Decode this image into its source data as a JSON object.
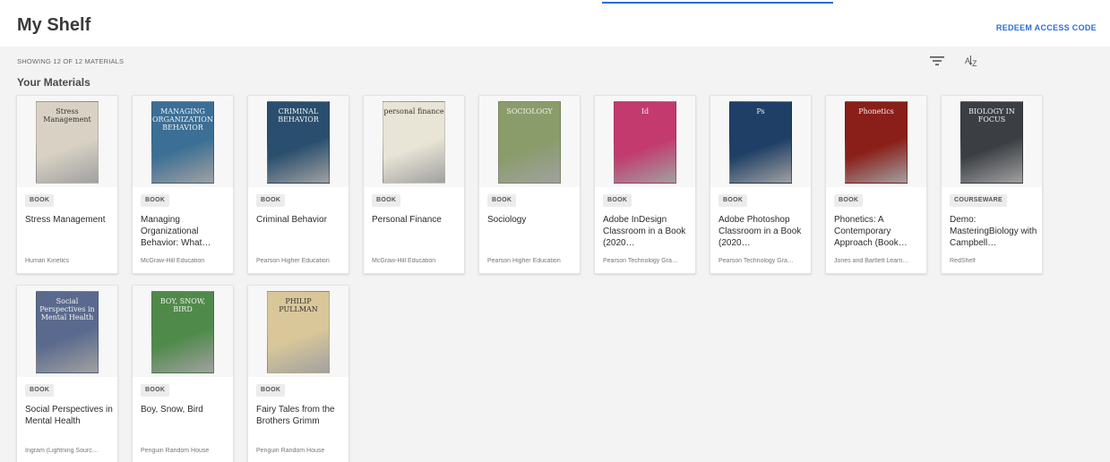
{
  "header": {
    "title": "My Shelf",
    "redeem_label": "REDEEM ACCESS CODE"
  },
  "toolbar": {
    "showing": "SHOWING 12 OF 12 MATERIALS",
    "filter_icon": "filter-icon",
    "sort_icon": "sort-az-icon",
    "sort_glyph": "A↓Z"
  },
  "section": {
    "title": "Your Materials"
  },
  "materials": [
    {
      "type": "BOOK",
      "title": "Stress Management",
      "publisher": "Human Kinetics",
      "cover_text": "Stress Management",
      "cover_color": "#d9d2c4"
    },
    {
      "type": "BOOK",
      "title": "Managing Organizational Behavior: What…",
      "publisher": "McGraw-Hill Education",
      "cover_text": "MANAGING ORGANIZATIONAL BEHAVIOR",
      "cover_color": "#3b6f96"
    },
    {
      "type": "BOOK",
      "title": "Criminal Behavior",
      "publisher": "Pearson Higher Education",
      "cover_text": "CRIMINAL BEHAVIOR",
      "cover_color": "#2a4f6e"
    },
    {
      "type": "BOOK",
      "title": "Personal Finance",
      "publisher": "McGraw-Hill Education",
      "cover_text": "personal finance",
      "cover_color": "#e8e4d6"
    },
    {
      "type": "BOOK",
      "title": "Sociology",
      "publisher": "Pearson Higher Education",
      "cover_text": "SOCIOLOGY",
      "cover_color": "#8a9c6a"
    },
    {
      "type": "BOOK",
      "title": "Adobe InDesign Classroom in a Book (2020…",
      "publisher": "Pearson Technology Gra…",
      "cover_text": "Id",
      "cover_color": "#c23a6e"
    },
    {
      "type": "BOOK",
      "title": "Adobe Photoshop Classroom in a Book (2020…",
      "publisher": "Pearson Technology Gra…",
      "cover_text": "Ps",
      "cover_color": "#1f3f66"
    },
    {
      "type": "BOOK",
      "title": "Phonetics: A Contemporary Approach (Book…",
      "publisher": "Jones and Bartlett Learn…",
      "cover_text": "Phonetics",
      "cover_color": "#8a1e18"
    },
    {
      "type": "COURSEWARE",
      "title": "Demo: MasteringBiology with Campbell…",
      "publisher": "RedShelf",
      "cover_text": "BIOLOGY IN FOCUS",
      "cover_color": "#3b3f44"
    },
    {
      "type": "BOOK",
      "title": "Social Perspectives in Mental Health",
      "publisher": "Ingram (Lightning Sourc…",
      "cover_text": "Social Perspectives in Mental Health",
      "cover_color": "#5a6a8e"
    },
    {
      "type": "BOOK",
      "title": "Boy, Snow, Bird",
      "publisher": "Penguin Random House",
      "cover_text": "BOY, SNOW, BIRD",
      "cover_color": "#4f8a4a"
    },
    {
      "type": "BOOK",
      "title": "Fairy Tales from the Brothers Grimm",
      "publisher": "Penguin Random House",
      "cover_text": "PHILIP PULLMAN",
      "cover_color": "#d9c79a"
    }
  ]
}
